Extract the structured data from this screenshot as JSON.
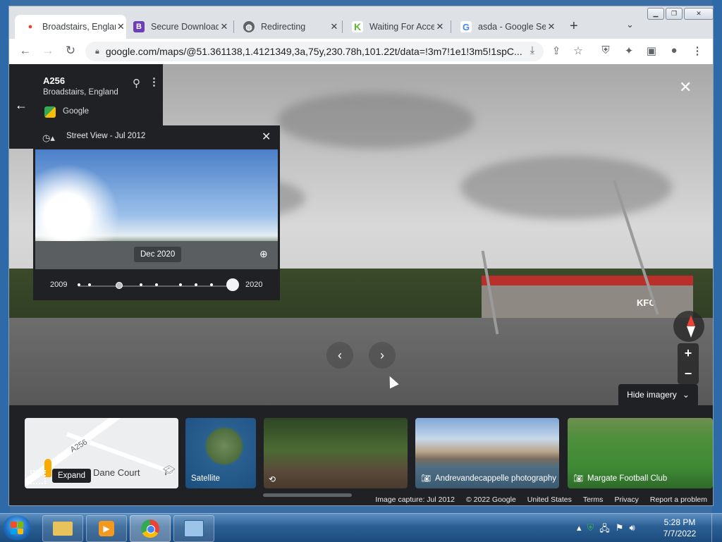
{
  "browser": {
    "tabs": [
      {
        "title": "Broadstairs, England",
        "favicon": "maps-pin-icon"
      },
      {
        "title": "Secure Download",
        "favicon": "b-icon"
      },
      {
        "title": "Redirecting",
        "favicon": "globe-icon"
      },
      {
        "title": "Waiting For Access",
        "favicon": "k-icon"
      },
      {
        "title": "asda - Google Search",
        "favicon": "google-icon"
      }
    ],
    "url": "google.com/maps/@51.361138,1.4121349,3a,75y,230.78h,101.22t/data=!3m7!1e1!3m5!1spC..."
  },
  "place": {
    "road": "A256",
    "location": "Broadstairs, England",
    "provider": "Google"
  },
  "timeline": {
    "title": "Street View - Jul 2012",
    "selected_date": "Dec 2020",
    "start_year": "2009",
    "end_year": "2020"
  },
  "pano": {
    "kfc_sign": "KFC",
    "zoom_in": "+",
    "zoom_out": "−",
    "hide_imagery": "Hide imagery"
  },
  "strip": {
    "map_road": "A256",
    "map_place": "Dane Court",
    "expand": "Expand",
    "satellite": "Satellite",
    "photo1": "Andrevandecappelle photography",
    "photo2": "Margate Football Club"
  },
  "footer": {
    "capture": "Image capture: Jul 2012",
    "copyright": "© 2022 Google",
    "region": "United States",
    "terms": "Terms",
    "privacy": "Privacy",
    "report": "Report a problem"
  },
  "taskbar": {
    "time": "5:28 PM",
    "date": "7/7/2022"
  }
}
